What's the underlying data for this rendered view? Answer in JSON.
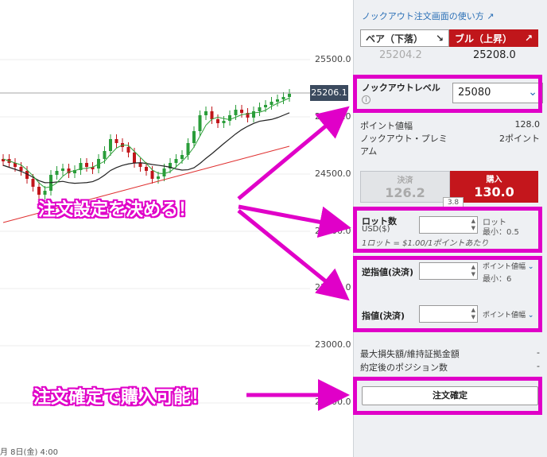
{
  "chart": {
    "current_price_tag": "25206.1",
    "y_axis_labels": [
      "25500.0",
      "25000.0",
      "24500.0",
      "24000.0",
      "23500.0",
      "23000.0",
      "22500.0"
    ],
    "date_label": "月 8日(金) 4:00"
  },
  "panel": {
    "help_link": "ノックアウト注文画面の使い方",
    "direction": {
      "bear_label": "ベア（下落）",
      "bull_label": "ブル（上昇）",
      "bear_price": "25204.2",
      "bull_price": "25208.0"
    },
    "knockout": {
      "label": "ノックアウトレベル",
      "value": "25080"
    },
    "point_width": {
      "label": "ポイント値幅",
      "value": "128.0"
    },
    "premium": {
      "label": "ノックアウト・プレミアム",
      "value": "2ポイント"
    },
    "trade": {
      "sell_label": "決済",
      "sell_value": "126.2",
      "buy_label": "購入",
      "buy_value": "130.0",
      "spread": "3.8"
    },
    "lot": {
      "label": "ロット数",
      "sub": "USD($)",
      "unit": "ロット",
      "min": "最小：0.5",
      "note": "1ロット = $1.00/1ポイントあたり",
      "value": ""
    },
    "stop_loss": {
      "label": "逆指値(決済)",
      "unit": "ポイント値幅",
      "min": "最小：6",
      "value": ""
    },
    "take_profit": {
      "label": "指値(決済)",
      "unit": "ポイント値幅",
      "value": ""
    },
    "max_loss": {
      "label": "最大損失額/維持証拠金額",
      "value": "-"
    },
    "positions_after": {
      "label": "約定後のポジション数",
      "value": "-"
    },
    "confirm_label": "注文確定"
  },
  "annotations": {
    "callout_settings": "注文設定を決める！",
    "callout_confirm": "注文確定で購入可能！"
  },
  "colors": {
    "highlight": "#e000c8",
    "bull": "#c0161b",
    "bear_candle": "#c0161b",
    "bull_candle": "#2a9d3a"
  }
}
